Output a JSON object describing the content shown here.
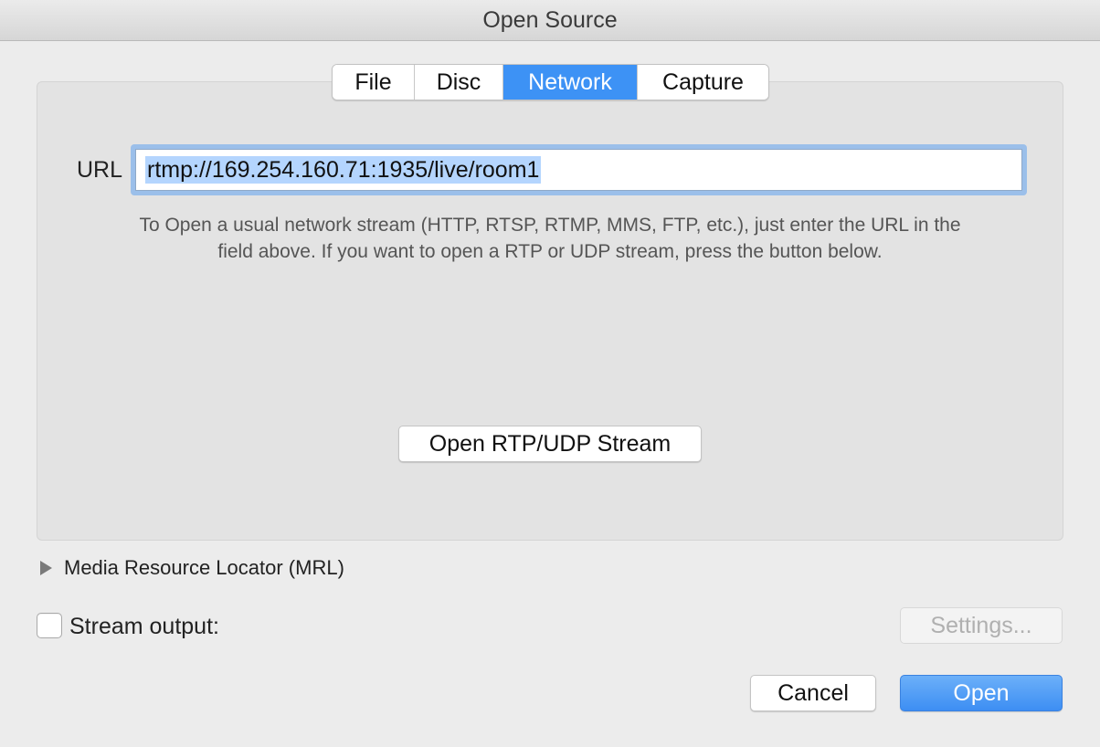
{
  "window": {
    "title": "Open Source"
  },
  "tabs": [
    {
      "label": "File",
      "active": false
    },
    {
      "label": "Disc",
      "active": false
    },
    {
      "label": "Network",
      "active": true
    },
    {
      "label": "Capture",
      "active": false
    }
  ],
  "network": {
    "url_label": "URL",
    "url_value": "rtmp://169.254.160.71:1935/live/room1",
    "help_line1": "To Open a usual network stream (HTTP, RTSP, RTMP, MMS, FTP, etc.), just enter the URL in the",
    "help_line2": "field above. If you want to open a RTP or UDP stream, press the button below.",
    "rtp_button": "Open RTP/UDP Stream"
  },
  "mrl": {
    "label": "Media Resource Locator (MRL)",
    "icon": "disclosure-triangle-right-icon"
  },
  "stream_output": {
    "label": "Stream output:",
    "checked": false,
    "settings_button": "Settings..."
  },
  "footer": {
    "cancel_button": "Cancel",
    "open_button": "Open"
  },
  "colors": {
    "accent": "#3d92f5",
    "panel": "#e3e3e3",
    "window": "#ececec"
  }
}
